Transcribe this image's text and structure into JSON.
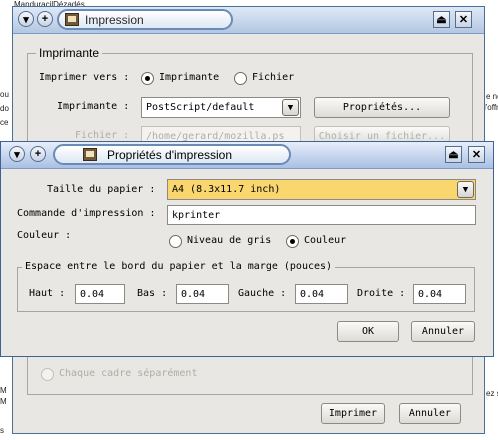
{
  "background": {
    "fragments": [
      "ManduracilDézadés",
      "ou",
      "do",
      "ce",
      "e ne",
      "l'offre",
      "M",
      "M",
      "ez s",
      "s"
    ]
  },
  "back_window": {
    "title": "Impression",
    "printer_group_title": "Imprimante",
    "print_to_label": "Imprimer vers :",
    "print_to_options": [
      "Imprimante",
      "Fichier"
    ],
    "printer_label": "Imprimante :",
    "printer_value": "PostScript/default",
    "properties_button": "Propriétés...",
    "file_label": "Fichier :",
    "file_value": "/home/gerard/mozilla.ps",
    "choose_file_button": "Choisir un fichier...",
    "each_frame_option": "Chaque cadre séparément",
    "print_button": "Imprimer",
    "cancel_button": "Annuler"
  },
  "dialog": {
    "title": "Propriétés d'impression",
    "paper_size_label": "Taille du papier :",
    "paper_size_value": "A4 (8.3x11.7 inch)",
    "print_command_label": "Commande d'impression :",
    "print_command_value": "kprinter",
    "color_label": "Couleur :",
    "color_options": [
      "Niveau de gris",
      "Couleur"
    ],
    "color_selected": "Couleur",
    "margins_group_title": "Espace entre le bord du papier et la marge (pouces)",
    "margins": {
      "top_label": "Haut :",
      "top_value": "0.04",
      "bottom_label": "Bas :",
      "bottom_value": "0.04",
      "left_label": "Gauche :",
      "left_value": "0.04",
      "right_label": "Droite :",
      "right_value": "0.04"
    },
    "ok_button": "OK",
    "cancel_button": "Annuler"
  },
  "colors": {
    "window_bg": "#e9e7e3",
    "titlebar": "#b3c7e2",
    "highlight_combo": "#f9d66e"
  }
}
